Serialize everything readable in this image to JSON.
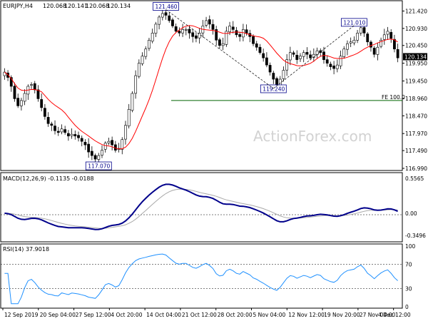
{
  "chart_data": [
    {
      "type": "candlestick",
      "instrument": "EURJPY,H4",
      "ohlc": {
        "open": 120.068,
        "high": 120.141,
        "low": 120.068,
        "close": 120.134
      },
      "last_price_label": "120.134",
      "ylim": [
        116.99,
        121.65
      ],
      "yticks": [
        "121.420",
        "120.930",
        "120.450",
        "119.950",
        "119.450",
        "118.960",
        "118.470",
        "117.970",
        "117.490",
        "116.990"
      ],
      "moving_average_color": "#ff0000",
      "candle_up_color": "#ffffff",
      "candle_down_color": "#000000",
      "close_series": [
        119.7,
        119.55,
        119.3,
        118.95,
        118.75,
        118.9,
        119.1,
        119.3,
        119.35,
        119.2,
        118.95,
        118.7,
        118.45,
        118.25,
        118.2,
        118.05,
        118.0,
        118.1,
        118.0,
        117.9,
        117.95,
        117.9,
        117.85,
        117.75,
        117.65,
        117.45,
        117.35,
        117.25,
        117.35,
        117.5,
        117.7,
        117.75,
        117.65,
        117.5,
        117.55,
        117.8,
        118.2,
        118.65,
        119.1,
        119.6,
        119.95,
        120.15,
        120.35,
        120.6,
        120.8,
        121.05,
        121.25,
        121.35,
        121.3,
        121.15,
        121.0,
        120.85,
        120.8,
        120.9,
        120.9,
        120.8,
        120.7,
        120.65,
        120.8,
        121.0,
        121.15,
        121.05,
        120.9,
        120.6,
        120.45,
        120.5,
        120.85,
        121.0,
        120.9,
        120.75,
        120.7,
        120.9,
        120.8,
        120.7,
        120.5,
        120.4,
        120.25,
        120.1,
        119.9,
        119.7,
        119.5,
        119.35,
        119.5,
        119.75,
        120.05,
        120.25,
        120.2,
        120.05,
        120.15,
        120.25,
        120.2,
        120.1,
        120.2,
        120.3,
        120.25,
        120.05,
        119.95,
        119.85,
        119.8,
        119.9,
        120.15,
        120.35,
        120.5,
        120.55,
        120.6,
        120.8,
        120.95,
        120.8,
        120.55,
        120.4,
        120.2,
        120.4,
        120.6,
        120.75,
        120.85,
        120.65,
        120.35,
        120.1
      ],
      "annotations": [
        {
          "label": "121.460",
          "price": 121.46
        },
        {
          "label": "117.070",
          "price": 117.07
        },
        {
          "label": "119.240",
          "price": 119.24
        },
        {
          "label": "121.010",
          "price": 121.01
        },
        {
          "label": "FE 100.0",
          "price": 118.9
        }
      ]
    },
    {
      "type": "line",
      "name": "MACD(12,26,9) -0.1135 -0.0188",
      "ylim": [
        -0.42,
        0.6
      ],
      "yticks": [
        "0.5565",
        "0.00",
        "-0.3496"
      ],
      "macd_color": "#00008b",
      "signal_color": "#a9a9a9"
    },
    {
      "type": "line",
      "name": "RSI(14) 37.9018",
      "ylim": [
        0,
        100
      ],
      "yticks": [
        "100",
        "70",
        "30",
        "0"
      ],
      "color": "#1e90ff",
      "levels": [
        70,
        30
      ]
    }
  ],
  "x_labels": [
    "12 Sep 2019",
    "20 Sep 04:00",
    "27 Sep 12:00",
    "4 Oct 20:00",
    "14 Oct 04:00",
    "21 Oct 12:00",
    "28 Oct 20:00",
    "5 Nov 04:00",
    "12 Nov 12:00",
    "19 Nov 20:00",
    "27 Nov 04:00",
    "4 Dec 12:00"
  ],
  "watermark": "ActionForex.com"
}
